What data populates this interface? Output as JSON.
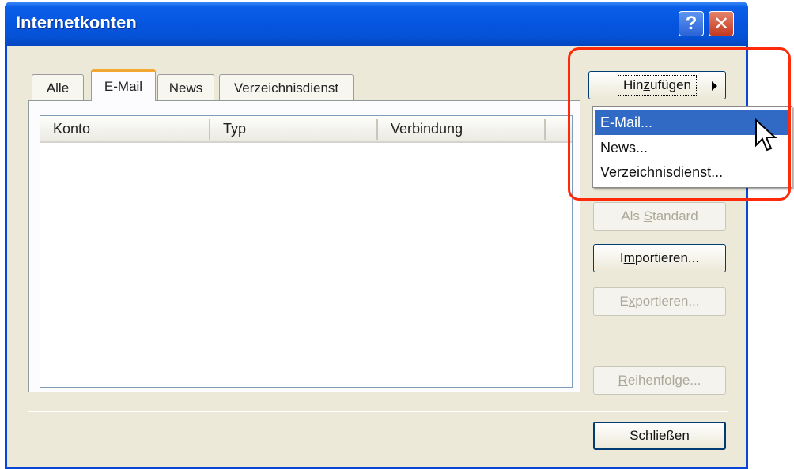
{
  "window": {
    "title": "Internetkonten",
    "help_label": "?",
    "close_label": "✕"
  },
  "tabs": [
    {
      "label": "Alle",
      "active": false
    },
    {
      "label": "E-Mail",
      "active": true
    },
    {
      "label": "News",
      "active": false
    },
    {
      "label": "Verzeichnisdienst",
      "active": false
    }
  ],
  "listview": {
    "columns": [
      "Konto",
      "Typ",
      "Verbindung"
    ],
    "rows": []
  },
  "buttons": {
    "add": {
      "label": "Hinzufügen",
      "mnemonic_prefix": "Hin",
      "mnemonic": "z",
      "mnemonic_suffix": "ufügen"
    },
    "default": {
      "prefix": "Als ",
      "mnemonic": "S",
      "suffix": "tandard",
      "enabled": false
    },
    "import": {
      "prefix": "I",
      "mnemonic": "m",
      "suffix": "portieren...",
      "enabled": true
    },
    "export": {
      "prefix": "E",
      "mnemonic": "x",
      "suffix": "portieren...",
      "enabled": false
    },
    "order": {
      "prefix": "",
      "mnemonic": "R",
      "suffix": "eihenfolge...",
      "enabled": false
    },
    "close": {
      "label": "Schließen"
    }
  },
  "add_menu": {
    "items": [
      {
        "label": "E-Mail...",
        "highlighted": true
      },
      {
        "label": "News...",
        "highlighted": false
      },
      {
        "label": "Verzeichnisdienst...",
        "highlighted": false
      }
    ]
  },
  "colors": {
    "accent": "#0552d6",
    "menu_highlight": "#316ac5",
    "annotation": "#ff2a0a"
  }
}
